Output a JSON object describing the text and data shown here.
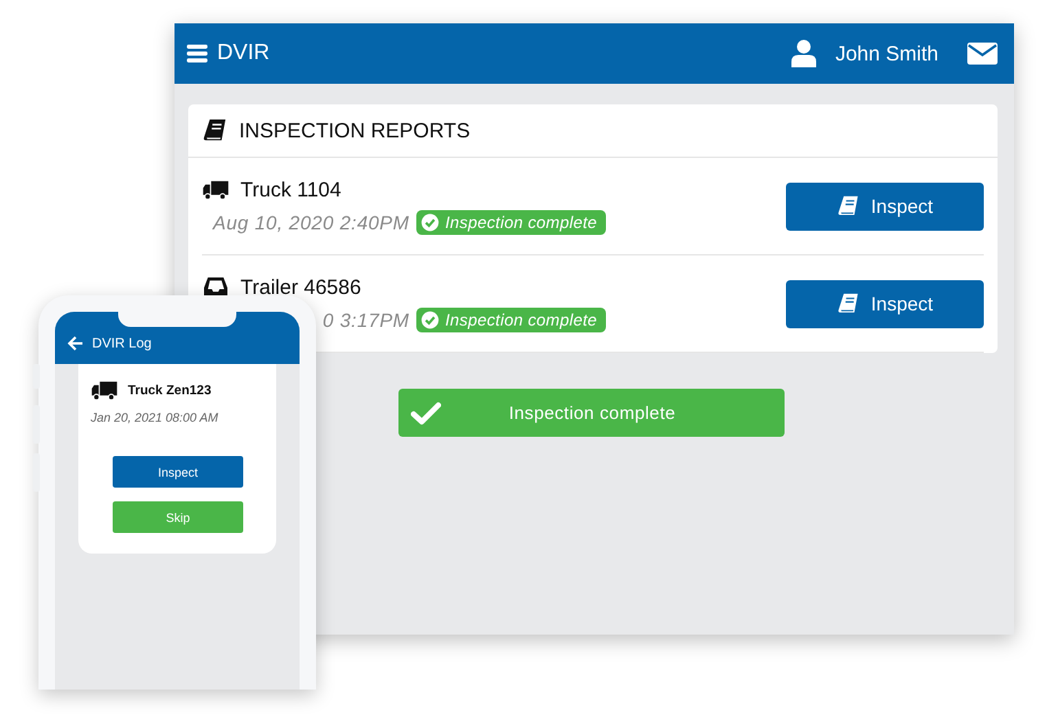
{
  "tablet": {
    "app_title": "DVIR",
    "user_name": "John Smith",
    "section_title": "INSPECTION REPORTS",
    "reports": [
      {
        "kind": "truck",
        "name": "Truck 1104",
        "datetime": "Aug 10, 2020 2:40PM",
        "status": "Inspection complete",
        "action": "Inspect"
      },
      {
        "kind": "trailer",
        "name": "Trailer 46586",
        "datetime": "0 3:17PM",
        "status": "Inspection complete",
        "action": "Inspect"
      }
    ],
    "banner": "Inspection complete"
  },
  "phone": {
    "title": "DVIR Log",
    "vehicle": "Truck Zen123",
    "datetime": "Jan 20, 2021 08:00 AM",
    "buttons": [
      {
        "kind": "primary",
        "label": "Inspect"
      },
      {
        "kind": "secondary",
        "label": "Skip"
      }
    ]
  }
}
